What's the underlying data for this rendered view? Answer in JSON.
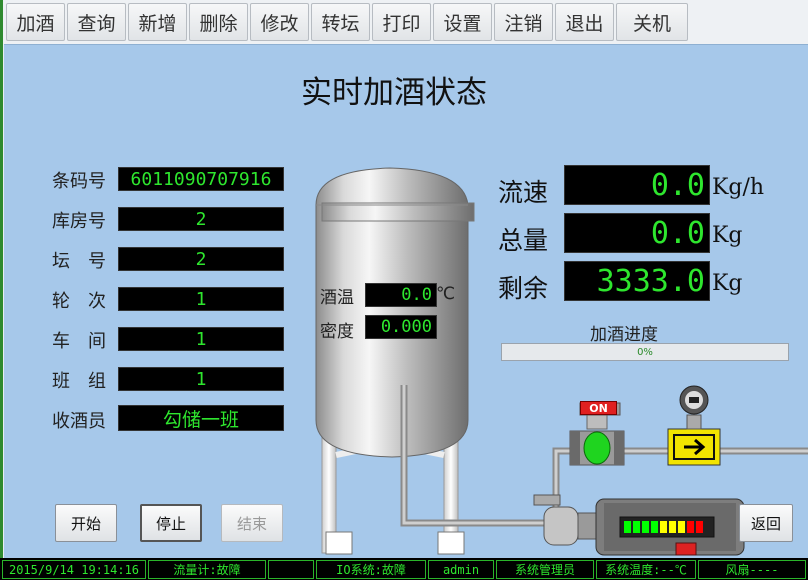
{
  "menu": [
    "加酒",
    "查询",
    "新增",
    "删除",
    "修改",
    "转坛",
    "打印",
    "设置",
    "注销",
    "退出",
    "关机"
  ],
  "title": "实时加酒状态",
  "fields": [
    {
      "label": "条码号",
      "value": "6011090707916"
    },
    {
      "label": "库房号",
      "value": "2"
    },
    {
      "label": "坛　号",
      "value": "2"
    },
    {
      "label": "轮　次",
      "value": "1"
    },
    {
      "label": "车　间",
      "value": "1"
    },
    {
      "label": "班　组",
      "value": "1"
    },
    {
      "label": "收酒员",
      "value": "勾储一班"
    }
  ],
  "tank": {
    "temp_label": "酒温",
    "temp_value": "0.0",
    "temp_unit": "℃",
    "density_label": "密度",
    "density_value": "0.000"
  },
  "metrics": [
    {
      "label": "流速",
      "value": "0.0",
      "unit": "Kg/h"
    },
    {
      "label": "总量",
      "value": "0.0",
      "unit": "Kg"
    },
    {
      "label": "剩余",
      "value": "3333.0",
      "unit": "Kg"
    }
  ],
  "progress": {
    "label": "加酒进度",
    "text": "0%",
    "fraction": 0.0
  },
  "valve": {
    "state": "ON"
  },
  "buttons": {
    "start": "开始",
    "stop": "停止",
    "end": "结束",
    "back": "返回"
  },
  "status": {
    "datetime": "2015/9/14 19:14:16",
    "flowmeter": "流量计:故障",
    "io": "IO系统:故障",
    "user": "admin",
    "role": "系统管理员",
    "sys_temp": "系统温度:--℃",
    "fan": "风扇----"
  },
  "colors": {
    "panel": "#a6c8ea",
    "lcd_text": "#2ee62e",
    "valve_on": "#e02020",
    "arrow_box": "#f2e400"
  }
}
